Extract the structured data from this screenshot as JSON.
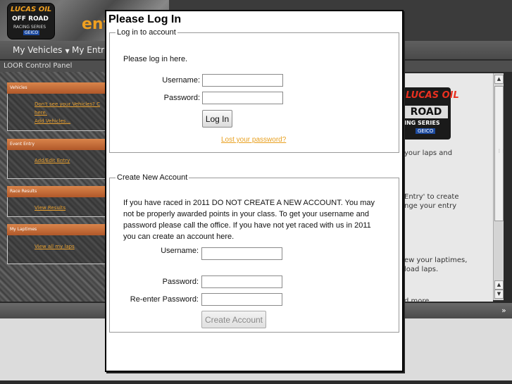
{
  "header": {
    "logo": {
      "line1": "LUCAS OIL",
      "line2": "OFF ROAD",
      "line3": "RACING SERIES",
      "line4": "GEICO"
    },
    "word": "ent"
  },
  "nav": {
    "items": [
      {
        "label": "My Vehicles"
      },
      {
        "label": "My Entrie"
      }
    ]
  },
  "panel": {
    "title": "LOOR Control Panel"
  },
  "left_boxes": [
    {
      "header": "Vehicles",
      "links": [
        "Don't see your Vehicles? C",
        "here.",
        "Add Vehicles..."
      ]
    },
    {
      "header": "Event Entry",
      "links": [
        "Add/Edit Entry"
      ]
    },
    {
      "header": "Race Results",
      "links": [
        "View Results"
      ]
    },
    {
      "header": "My Laptimes",
      "links": [
        "View all my laps"
      ]
    }
  ],
  "right_panel": {
    "logo": {
      "line1": "LUCAS OIL",
      "line2": "ROAD",
      "line3": "ING SERIES",
      "line4": "GEICO"
    },
    "text1": "your laps and",
    "text2a": "Entry' to create",
    "text2b": "nge your entry",
    "text3a": "ew your laptimes,",
    "text3b": "load laps.",
    "text4": "d more"
  },
  "modal": {
    "title": "Please Log In",
    "login": {
      "legend": "Log in to account",
      "intro": "Please log in here.",
      "username_label": "Username:",
      "username_value": "",
      "password_label": "Password:",
      "password_value": "",
      "button": "Log In",
      "lost_password": "Lost your password?"
    },
    "create": {
      "legend": "Create New Account",
      "notice": "If you have raced in 2011 DO NOT CREATE A NEW ACCOUNT. You may not be properly awarded points in your class. To get your username and password please call the office. If you have not yet raced with us in 2011 you can create an account here.",
      "username_label": "Username:",
      "password_label": "Password:",
      "reenter_label": "Re-enter Password:",
      "button": "Create Account"
    }
  },
  "colors": {
    "accent": "#e8a020",
    "box_header": "#c8703a",
    "modal_border": "#000000"
  }
}
